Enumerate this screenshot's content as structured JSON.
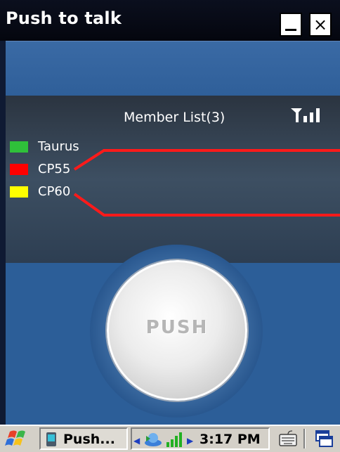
{
  "window": {
    "title": "Push to talk",
    "minimize_label": "_",
    "close_label": "×"
  },
  "member_list": {
    "title": "Member List(3)",
    "signal_icon": "signal-strength-icon",
    "members": [
      {
        "name": "Taurus",
        "color": "#2fc13a"
      },
      {
        "name": "CP55",
        "color": "#ff0000"
      },
      {
        "name": "CP60",
        "color": "#ffff00"
      }
    ],
    "highlight_color": "#ff0000"
  },
  "push_button": {
    "label": "PUSH"
  },
  "taskbar": {
    "start_icon": "windows-flag-icon",
    "task_label": "Push...",
    "clock": "3:17 PM",
    "keyboard_icon": "keyboard-icon",
    "windows_icon": "window-switch-icon"
  },
  "colors": {
    "titlebar": "#04060e",
    "app_background": "#2c5e98",
    "panel": "#34475a",
    "taskbar": "#d4d0c8"
  }
}
